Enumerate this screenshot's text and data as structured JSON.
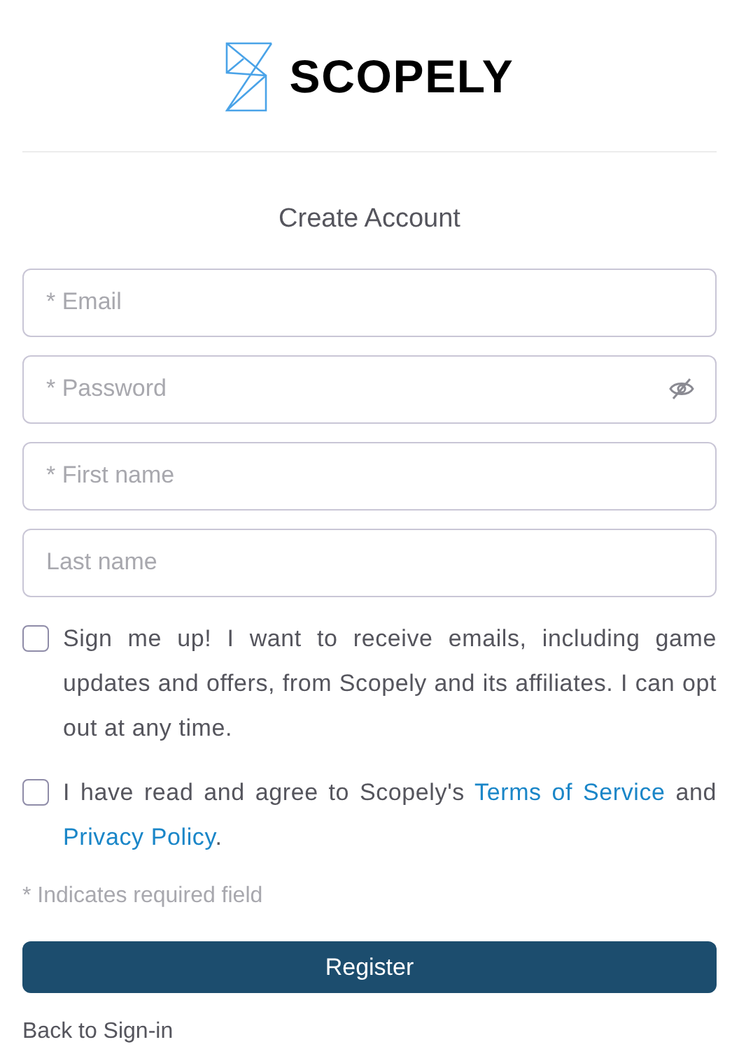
{
  "logo": {
    "text": "SCOPELY"
  },
  "title": "Create Account",
  "fields": [
    {
      "placeholder": "* Email",
      "kind": "text"
    },
    {
      "placeholder": "* Password",
      "kind": "password"
    },
    {
      "placeholder": "* First name",
      "kind": "text"
    },
    {
      "placeholder": "Last name",
      "kind": "text"
    }
  ],
  "checkboxes": [
    {
      "checked": false,
      "parts": [
        {
          "kind": "text",
          "text": "Sign me up! I want to receive emails, including game updates and offers, from Scopely and its affiliates. I can opt out at any time."
        }
      ]
    },
    {
      "checked": false,
      "parts": [
        {
          "kind": "text",
          "text": "I have read and agree to Scopely's "
        },
        {
          "kind": "link",
          "text": "Terms of Service"
        },
        {
          "kind": "text",
          "text": " and "
        },
        {
          "kind": "link",
          "text": "Privacy Policy"
        },
        {
          "kind": "text",
          "text": "."
        }
      ]
    }
  ],
  "required_note": "* Indicates required field",
  "register_button": "Register",
  "back_link": "Back to Sign-in"
}
